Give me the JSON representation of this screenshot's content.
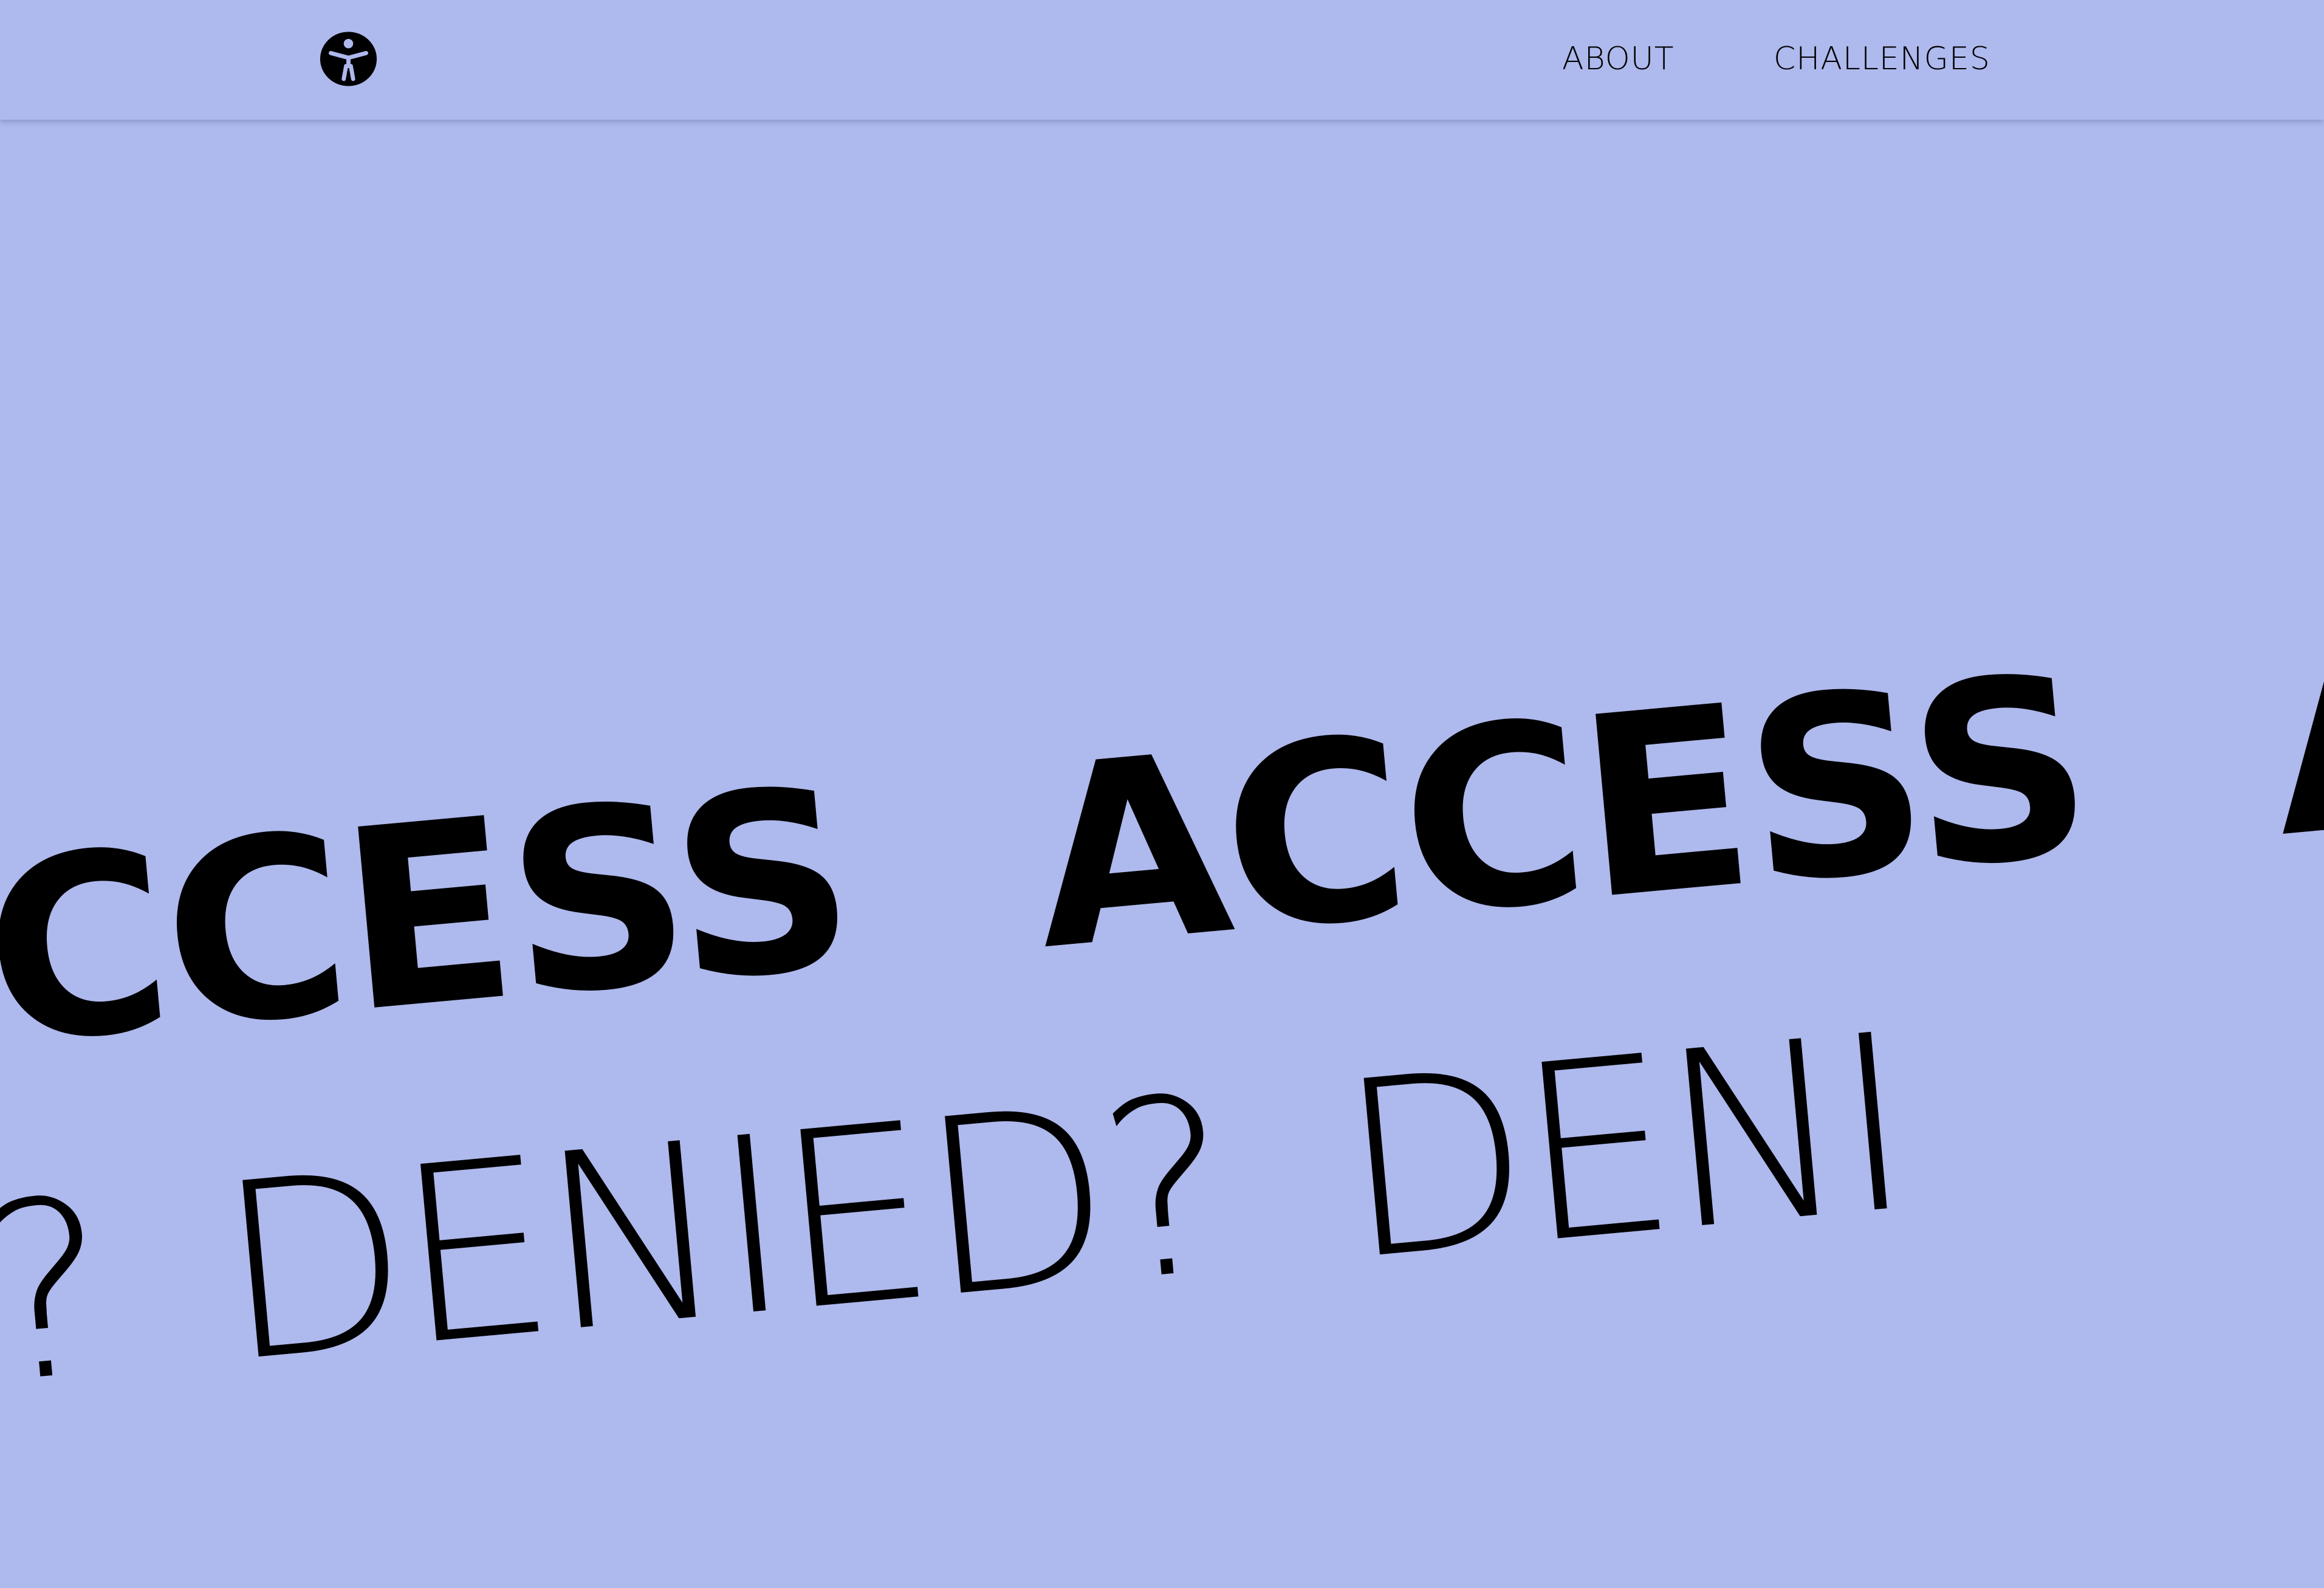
{
  "navbar": {
    "logo_icon": "accessibility-person-icon",
    "links": {
      "about": "ABOUT",
      "challenges": "CHALLENGES"
    }
  },
  "hero": {
    "line1": [
      "CCESS",
      "ACCESS",
      "A"
    ],
    "line2": [
      "?",
      "DENIED?",
      "DENI"
    ]
  },
  "colors": {
    "background": "#aeb9ed",
    "text": "#000000"
  }
}
